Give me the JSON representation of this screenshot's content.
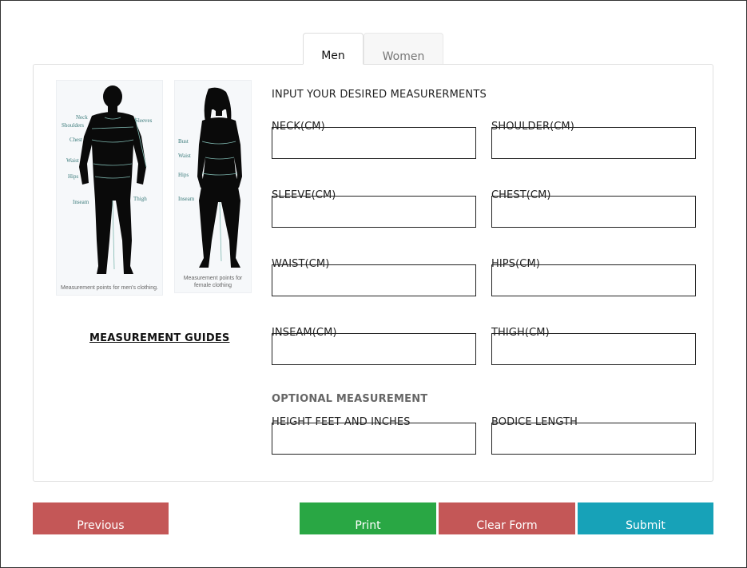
{
  "tabs": [
    {
      "label": "Men",
      "active": true
    },
    {
      "label": "Women",
      "active": false
    }
  ],
  "figures": {
    "men": {
      "caption": "Measurement points for men's clothing.",
      "labels": [
        "Neck",
        "Shoulders",
        "Sleeves",
        "Chest",
        "Waist",
        "Hips",
        "Inseam",
        "Thigh"
      ]
    },
    "women": {
      "caption": "Measurement points for female clothing",
      "labels": [
        "Bust",
        "Waist",
        "Hips",
        "Inseam"
      ]
    }
  },
  "guides_link": "MEASUREMENT GUIDES",
  "form": {
    "title": "INPUT YOUR DESIRED MEASURERMENTS",
    "fields": {
      "neck": {
        "label": "NECK(CM)",
        "value": ""
      },
      "shoulder": {
        "label": "SHOULDER(CM)",
        "value": ""
      },
      "sleeve": {
        "label": "SLEEVE(CM)",
        "value": ""
      },
      "chest": {
        "label": "CHEST(CM)",
        "value": ""
      },
      "waist": {
        "label": "WAIST(CM)",
        "value": ""
      },
      "hips": {
        "label": "HIPS(CM)",
        "value": ""
      },
      "inseam": {
        "label": "INSEAM(CM)",
        "value": ""
      },
      "thigh": {
        "label": "THIGH(CM)",
        "value": ""
      }
    },
    "optional_title": "OPTIONAL MEASUREMENT",
    "optional_fields": {
      "height": {
        "label": "HEIGHT FEET AND INCHES",
        "value": ""
      },
      "bodice": {
        "label": "BODICE LENGTH",
        "value": ""
      }
    }
  },
  "buttons": {
    "previous": "Previous",
    "print": "Print",
    "clear": "Clear Form",
    "submit": "Submit"
  },
  "colors": {
    "danger": "#c45757",
    "success": "#29a744",
    "info": "#17a2b8"
  }
}
